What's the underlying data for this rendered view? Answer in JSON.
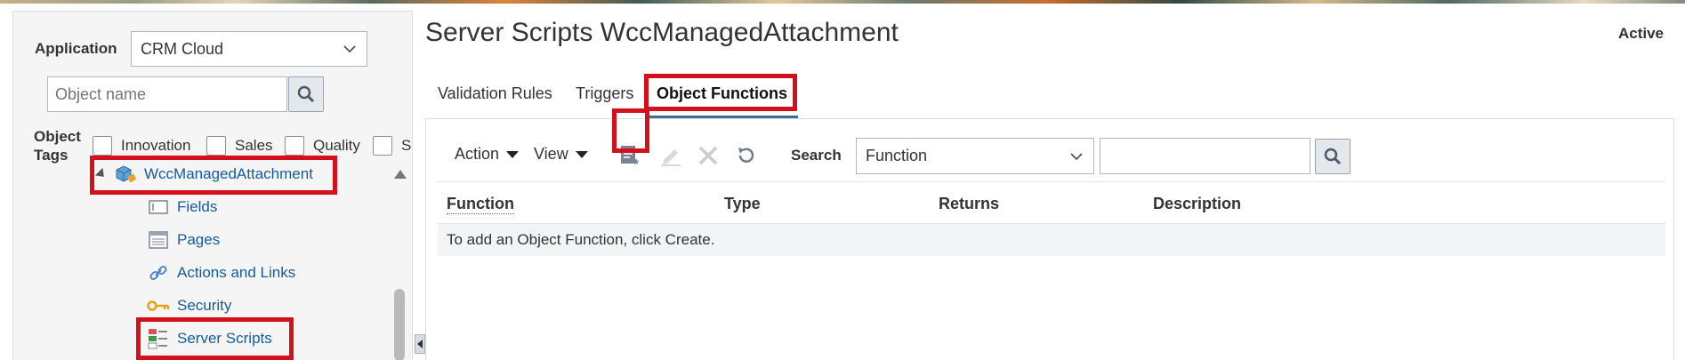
{
  "sidebar": {
    "application_label": "Application",
    "application_value": "CRM Cloud",
    "object_name_placeholder": "Object name",
    "object_tags_label": "Object\nTags",
    "tags": [
      "Innovation",
      "Sales",
      "Quality",
      "S"
    ],
    "tree": {
      "root": "WccManagedAttachment",
      "children": [
        "Fields",
        "Pages",
        "Actions and Links",
        "Security",
        "Server Scripts"
      ]
    }
  },
  "header": {
    "title": "Server Scripts WccManagedAttachment",
    "status": "Active"
  },
  "tabs": [
    "Validation Rules",
    "Triggers",
    "Object Functions"
  ],
  "active_tab": "Object Functions",
  "toolbar": {
    "action_label": "Action",
    "view_label": "View",
    "search_label": "Search",
    "search_field_value": "Function",
    "search_input_value": ""
  },
  "table": {
    "columns": [
      "Function",
      "Type",
      "Returns",
      "Description"
    ],
    "empty_message": "To add an Object Function, click Create."
  },
  "icons": {
    "create": "create-icon",
    "edit": "edit-pencil-icon",
    "delete": "delete-x-icon",
    "refresh": "refresh-icon",
    "search": "search-icon"
  },
  "colors": {
    "link": "#145c9e",
    "highlight": "#d4101d",
    "active_tab_underline": "#3b6e8f"
  }
}
